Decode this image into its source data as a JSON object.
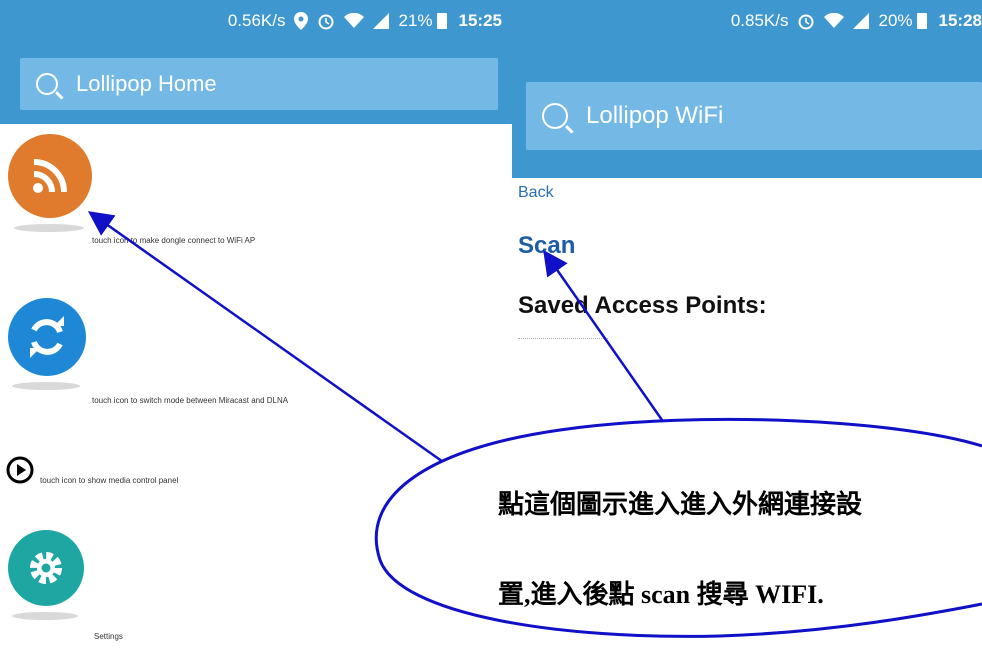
{
  "left": {
    "status": {
      "speed": "0.56K/s",
      "battery": "21%",
      "time": "15:25"
    },
    "search": {
      "title": "Lollipop Home"
    },
    "items": [
      {
        "label": "touch icon to make dongle connect to WiFi AP"
      },
      {
        "label": "touch icon to switch mode between Miracast and DLNA"
      },
      {
        "label": "touch icon to show media control panel"
      },
      {
        "label": "Settings"
      }
    ]
  },
  "right": {
    "status": {
      "speed": "0.85K/s",
      "battery": "20%",
      "time": "15:28"
    },
    "search": {
      "title": "Lollipop WiFi"
    },
    "back": "Back",
    "scan": "Scan",
    "saved_title": "Saved Access Points:"
  },
  "callout": {
    "line1": "點這個圖示進入進入外網連接設",
    "line2": "置,進入後點 scan 搜尋 WIFI."
  },
  "colors": {
    "appbar": "#3f97cf",
    "searchbox": "#74b9e6",
    "arrow": "#1010c8",
    "rss": "#e07a2d",
    "sync": "#1e88d6",
    "settings": "#1ea7a2"
  },
  "icons": [
    "search-icon",
    "location-icon",
    "alarm-icon",
    "wifi-icon",
    "signal-icon",
    "battery-icon",
    "rss-icon",
    "sync-icon",
    "play-icon",
    "settings-icon"
  ]
}
